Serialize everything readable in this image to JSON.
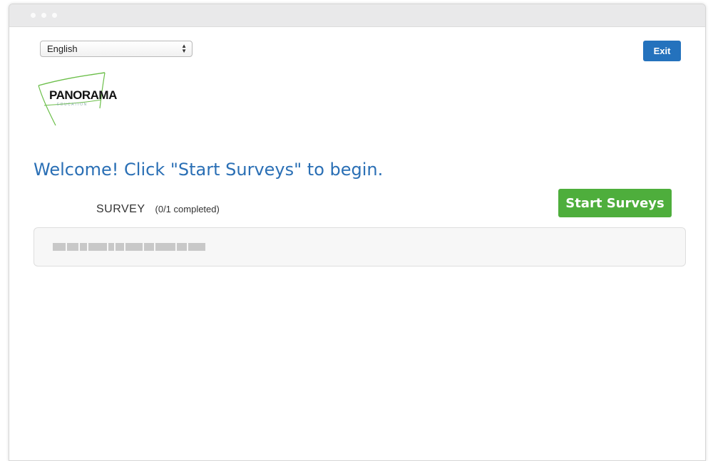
{
  "window": {
    "traffic_lights": [
      "close",
      "minimize",
      "maximize"
    ]
  },
  "language_select": {
    "selected": "English"
  },
  "header": {
    "exit_label": "Exit"
  },
  "logo": {
    "brand": "PANORAMA",
    "sub": "EDUCATION",
    "colors": {
      "swoosh": "#6cbf4a",
      "text": "#111111"
    }
  },
  "main": {
    "welcome": "Welcome! Click \"Start Surveys\" to begin.",
    "survey_label": "SURVEY",
    "survey_count": "(0/1 completed)",
    "start_button_label": "Start Surveys",
    "survey_items": [
      {
        "name": "[redacted]"
      }
    ]
  },
  "colors": {
    "accent_blue": "#2472bd",
    "heading_blue": "#2a6fb5",
    "start_green": "#4eae3c"
  }
}
